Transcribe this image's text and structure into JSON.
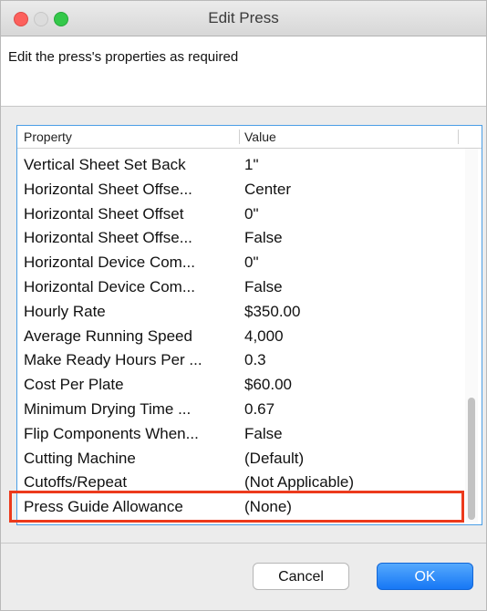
{
  "window": {
    "title": "Edit Press"
  },
  "instruction": "Edit the press's properties as required",
  "table": {
    "headers": {
      "property": "Property",
      "value": "Value"
    },
    "rows": [
      {
        "property": "Vertical Sheet Set Back",
        "value": "1\""
      },
      {
        "property": "Horizontal Sheet Offse...",
        "value": "Center"
      },
      {
        "property": "Horizontal Sheet Offset",
        "value": "0\""
      },
      {
        "property": "Horizontal Sheet Offse...",
        "value": "False"
      },
      {
        "property": "Horizontal Device Com...",
        "value": "0\""
      },
      {
        "property": "Horizontal Device Com...",
        "value": "False"
      },
      {
        "property": "Hourly Rate",
        "value": "$350.00"
      },
      {
        "property": "Average Running Speed",
        "value": "4,000"
      },
      {
        "property": "Make Ready Hours Per ...",
        "value": "0.3"
      },
      {
        "property": "Cost Per Plate",
        "value": "$60.00"
      },
      {
        "property": "Minimum Drying Time ...",
        "value": "0.67"
      },
      {
        "property": "Flip Components When...",
        "value": "False"
      },
      {
        "property": "Cutting Machine",
        "value": "(Default)"
      },
      {
        "property": "Cutoffs/Repeat",
        "value": "(Not Applicable)"
      },
      {
        "property": "Press Guide Allowance",
        "value": "(None)"
      }
    ],
    "highlight_color": "#ec3a1c"
  },
  "buttons": {
    "cancel": "Cancel",
    "ok": "OK"
  },
  "colors": {
    "close": "#fc605c",
    "zoom": "#34c84a",
    "ok_button": "#1677f5"
  }
}
